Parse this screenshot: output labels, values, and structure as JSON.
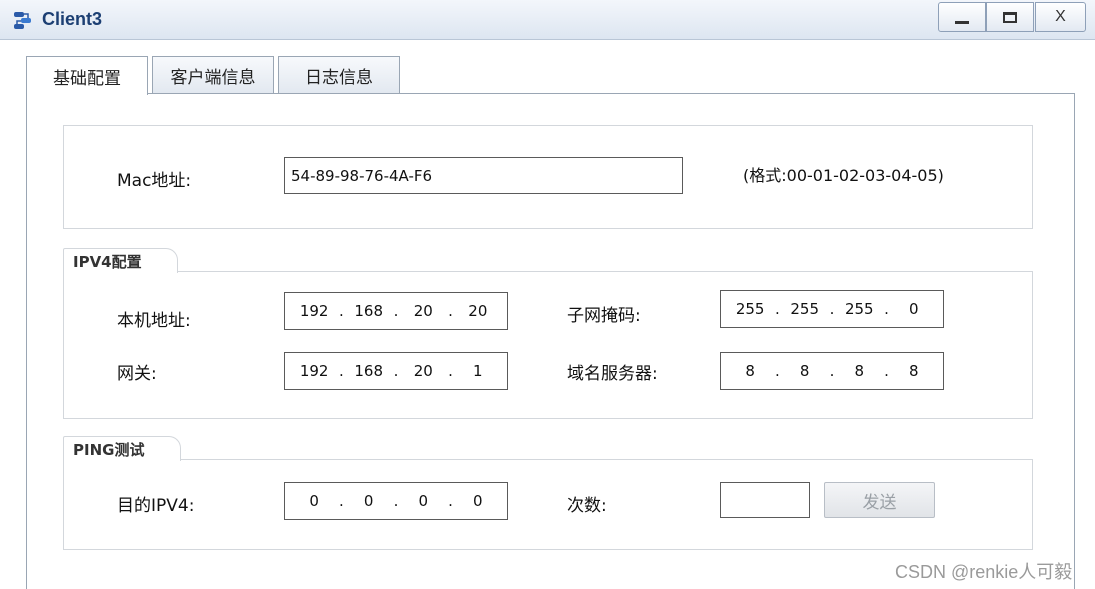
{
  "window": {
    "title": "Client3",
    "min_label": "",
    "max_label": "",
    "close_label": "X"
  },
  "tabs": [
    {
      "label": "基础配置"
    },
    {
      "label": "客户端信息"
    },
    {
      "label": "日志信息"
    }
  ],
  "mac": {
    "label": "Mac地址:",
    "value": "54-89-98-76-4A-F6",
    "hint": "(格式:00-01-02-03-04-05)"
  },
  "ipv4": {
    "legend": "IPV4配置",
    "local_label": "本机地址:",
    "local_ip": [
      "192",
      "168",
      "20",
      "20"
    ],
    "mask_label": "子网掩码:",
    "mask": [
      "255",
      "255",
      "255",
      "0"
    ],
    "gateway_label": "网关:",
    "gateway": [
      "192",
      "168",
      "20",
      "1"
    ],
    "dns_label": "域名服务器:",
    "dns": [
      "8",
      "8",
      "8",
      "8"
    ]
  },
  "ping": {
    "legend": "PING测试",
    "target_label": "目的IPV4:",
    "target": [
      "0",
      "0",
      "0",
      "0"
    ],
    "count_label": "次数:",
    "count_value": "",
    "send_label": "发送"
  },
  "watermark": "CSDN @renkie人可毅"
}
